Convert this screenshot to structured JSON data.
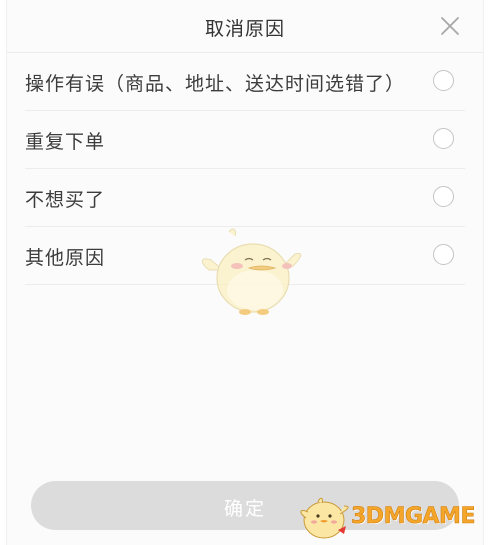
{
  "dialog": {
    "title": "取消原因",
    "close_icon": "close-icon"
  },
  "options": [
    {
      "label": "操作有误（商品、地址、送达时间选错了）",
      "selected": false
    },
    {
      "label": "重复下单",
      "selected": false
    },
    {
      "label": "不想买了",
      "selected": false
    },
    {
      "label": "其他原因",
      "selected": false
    }
  ],
  "confirm_button": {
    "label": "确定",
    "enabled": false
  },
  "watermark": {
    "text": "3DMGAME"
  },
  "colors": {
    "background": "#fbfbfb",
    "divider": "#ececec",
    "text": "#3c3c3c",
    "radio_border": "#c4c4c4",
    "button_disabled": "#dcdcdc",
    "watermark": "#f4a62a"
  }
}
